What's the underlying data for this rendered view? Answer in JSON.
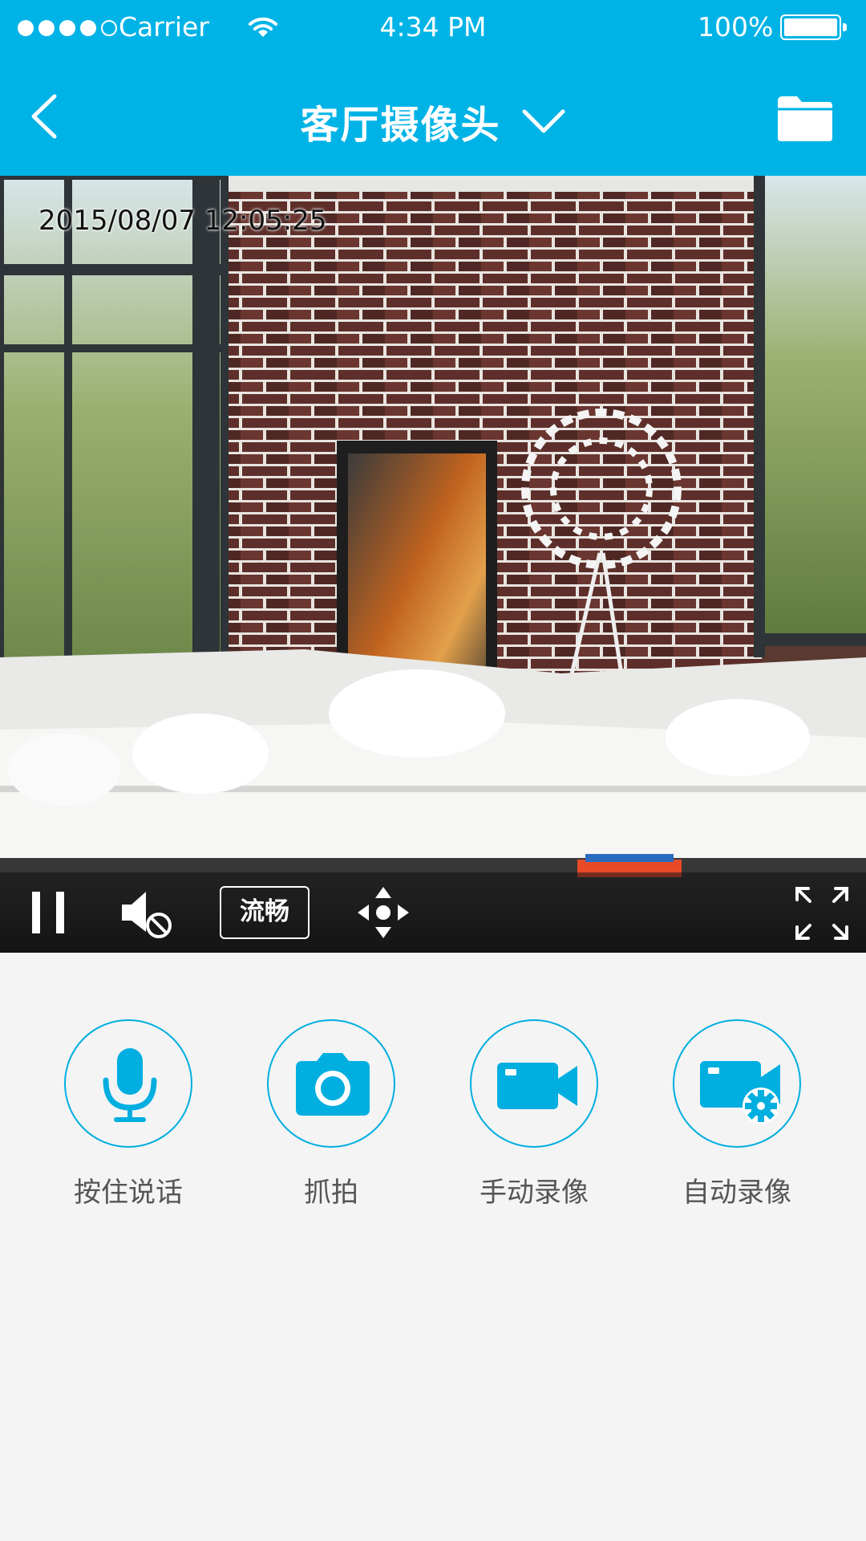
{
  "status_bar": {
    "carrier": "Carrier",
    "time": "4:34 PM",
    "battery": "100%"
  },
  "nav": {
    "title": "客厅摄像头",
    "back_icon": "chevron-left-icon",
    "title_icon": "chevron-down-icon",
    "right_icon": "folder-icon"
  },
  "video": {
    "timestamp": "2015/08/07 12:05:25",
    "controls": {
      "pause_icon": "pause-icon",
      "mute_icon": "speaker-muted-icon",
      "quality_label": "流畅",
      "ptz_icon": "direction-pad-icon",
      "fullscreen_icon": "fullscreen-icon"
    }
  },
  "actions": [
    {
      "label": "按住说话",
      "icon": "microphone-icon"
    },
    {
      "label": "抓拍",
      "icon": "camera-icon"
    },
    {
      "label": "手动录像",
      "icon": "video-camera-icon"
    },
    {
      "label": "自动录像",
      "icon": "video-camera-settings-icon"
    }
  ],
  "colors": {
    "accent": "#00b3e6",
    "icon_blue": "#00aee0",
    "background": "#f4f4f4",
    "label_gray": "#555555"
  }
}
